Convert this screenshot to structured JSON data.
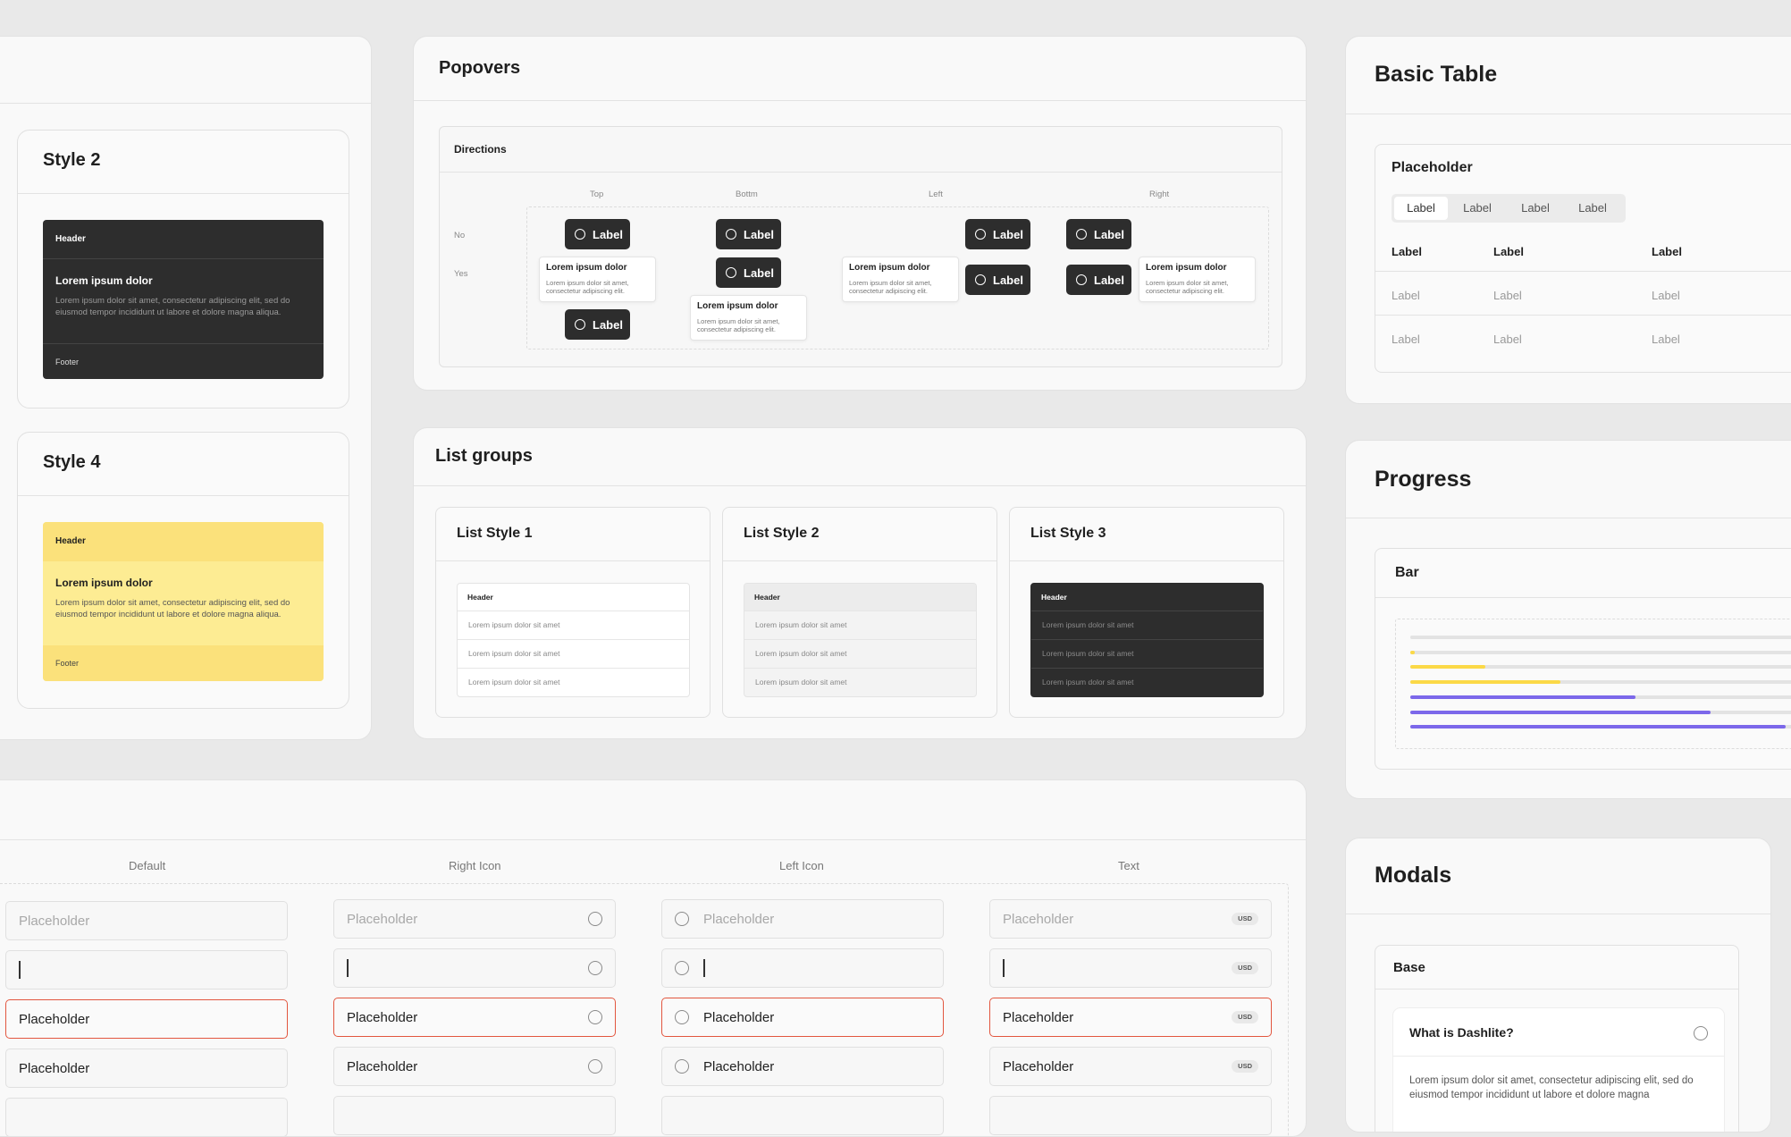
{
  "colors": {
    "yellow_header": "#fbe17b",
    "yellow_body": "#fdec93",
    "dark": "#2d2d2d",
    "error": "#e2563f",
    "purple": "#7c68ea",
    "yellow_bar": "#fbd947",
    "track": "#e3e3e3"
  },
  "cards": {
    "style2": {
      "title": "Style 2",
      "header": "Header",
      "body_title": "Lorem ipsum dolor",
      "body_text": "Lorem ipsum dolor sit amet, consectetur adipiscing elit, sed do eiusmod tempor incididunt ut labore et dolore magna aliqua.",
      "footer": "Footer"
    },
    "style4": {
      "title": "Style 4",
      "header": "Header",
      "body_title": "Lorem ipsum dolor",
      "body_text": "Lorem ipsum dolor sit amet, consectetur adipiscing elit, sed do eiusmod tempor incididunt ut labore et dolore magna aliqua.",
      "footer": "Footer"
    }
  },
  "popovers": {
    "title": "Popovers",
    "section": "Directions",
    "columns": [
      "Top",
      "Bottm",
      "Left",
      "Right"
    ],
    "rows": [
      "No",
      "Yes"
    ],
    "label": "Label",
    "tip_title": "Lorem ipsum dolor",
    "tip_text": "Lorem ipsum dolor sit amet, consectetur adipiscing elit."
  },
  "list_groups": {
    "title": "List groups",
    "styles": [
      {
        "title": "List Style 1",
        "header": "Header",
        "items": [
          "Lorem ipsum dolor sit amet",
          "Lorem ipsum dolor sit amet",
          "Lorem ipsum dolor sit amet"
        ]
      },
      {
        "title": "List Style 2",
        "header": "Header",
        "items": [
          "Lorem ipsum dolor sit amet",
          "Lorem ipsum dolor sit amet",
          "Lorem ipsum dolor sit amet"
        ]
      },
      {
        "title": "List Style 3",
        "header": "Header",
        "items": [
          "Lorem ipsum dolor sit amet",
          "Lorem ipsum dolor sit amet",
          "Lorem ipsum dolor sit amet"
        ]
      }
    ]
  },
  "inputs": {
    "columns": [
      "Default",
      "Right Icon",
      "Left Icon",
      "Text"
    ],
    "placeholder": "Placeholder",
    "value": "Placeholder",
    "unit": "USD"
  },
  "basic_table": {
    "title": "Basic Table",
    "card_title": "Placeholder",
    "tabs": [
      "Label",
      "Label",
      "Label",
      "Label"
    ],
    "headers": [
      "Label",
      "Label",
      "Label"
    ],
    "rows": [
      [
        "Label",
        "Label",
        "Label"
      ],
      [
        "Label",
        "Label",
        "Label"
      ]
    ]
  },
  "progress": {
    "title": "Progress",
    "card_title": "Bar",
    "bars": [
      {
        "color": "track",
        "level": 0
      },
      {
        "color": "yellow",
        "level": 0.01
      },
      {
        "color": "yellow",
        "level": 0.2
      },
      {
        "color": "yellow",
        "level": 0.4
      },
      {
        "color": "purple",
        "level": 0.6
      },
      {
        "color": "purple",
        "level": 0.8
      },
      {
        "color": "purple",
        "level": 1.0
      }
    ]
  },
  "modals": {
    "title": "Modals",
    "card_title": "Base",
    "question": "What is Dashlite?",
    "body": "Lorem ipsum dolor sit amet, consectetur adipiscing elit, sed do eiusmod tempor incididunt ut labore et dolore magna"
  }
}
